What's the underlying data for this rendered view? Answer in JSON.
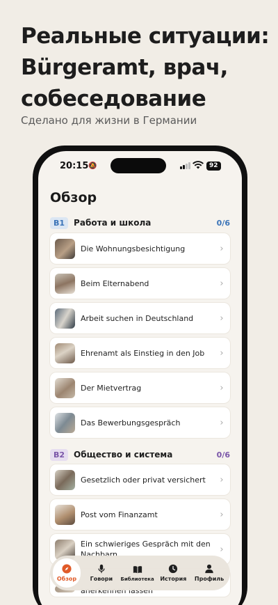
{
  "promo": {
    "headline": "Реальные ситуации: Bürgeramt, врач, собеседование",
    "subline": "Сделано для жизни в Германии"
  },
  "status": {
    "time": "20:15",
    "battery": "92"
  },
  "screen_title": "Обзор",
  "sections": [
    {
      "level": "B1",
      "name": "Работа и школа",
      "count": "0/6",
      "items": [
        "Die Wohnungsbesichtigung",
        "Beim Elternabend",
        "Arbeit suchen in Deutschland",
        "Ehrenamt als Einstieg in den Job",
        "Der Mietvertrag",
        "Das Bewerbungsgespräch"
      ]
    },
    {
      "level": "B2",
      "name": "Общество и система",
      "count": "0/6",
      "items": [
        "Gesetzlich oder privat versichert",
        "Post vom Finanzamt",
        "Ein schwieriges Gespräch mit den Nachbarn",
        "anerkennen lassen"
      ]
    }
  ],
  "tabs": [
    {
      "label": "Обзор",
      "icon": "compass-icon",
      "active": true
    },
    {
      "label": "Говори",
      "icon": "microphone-icon"
    },
    {
      "label": "Библиотека",
      "icon": "book-icon"
    },
    {
      "label": "История",
      "icon": "clock-icon"
    },
    {
      "label": "Профиль",
      "icon": "person-icon"
    }
  ],
  "colors": {
    "background": "#f1ede6",
    "accent": "#e05a28",
    "b1": "#3b74b8",
    "b2": "#7a55a8"
  }
}
